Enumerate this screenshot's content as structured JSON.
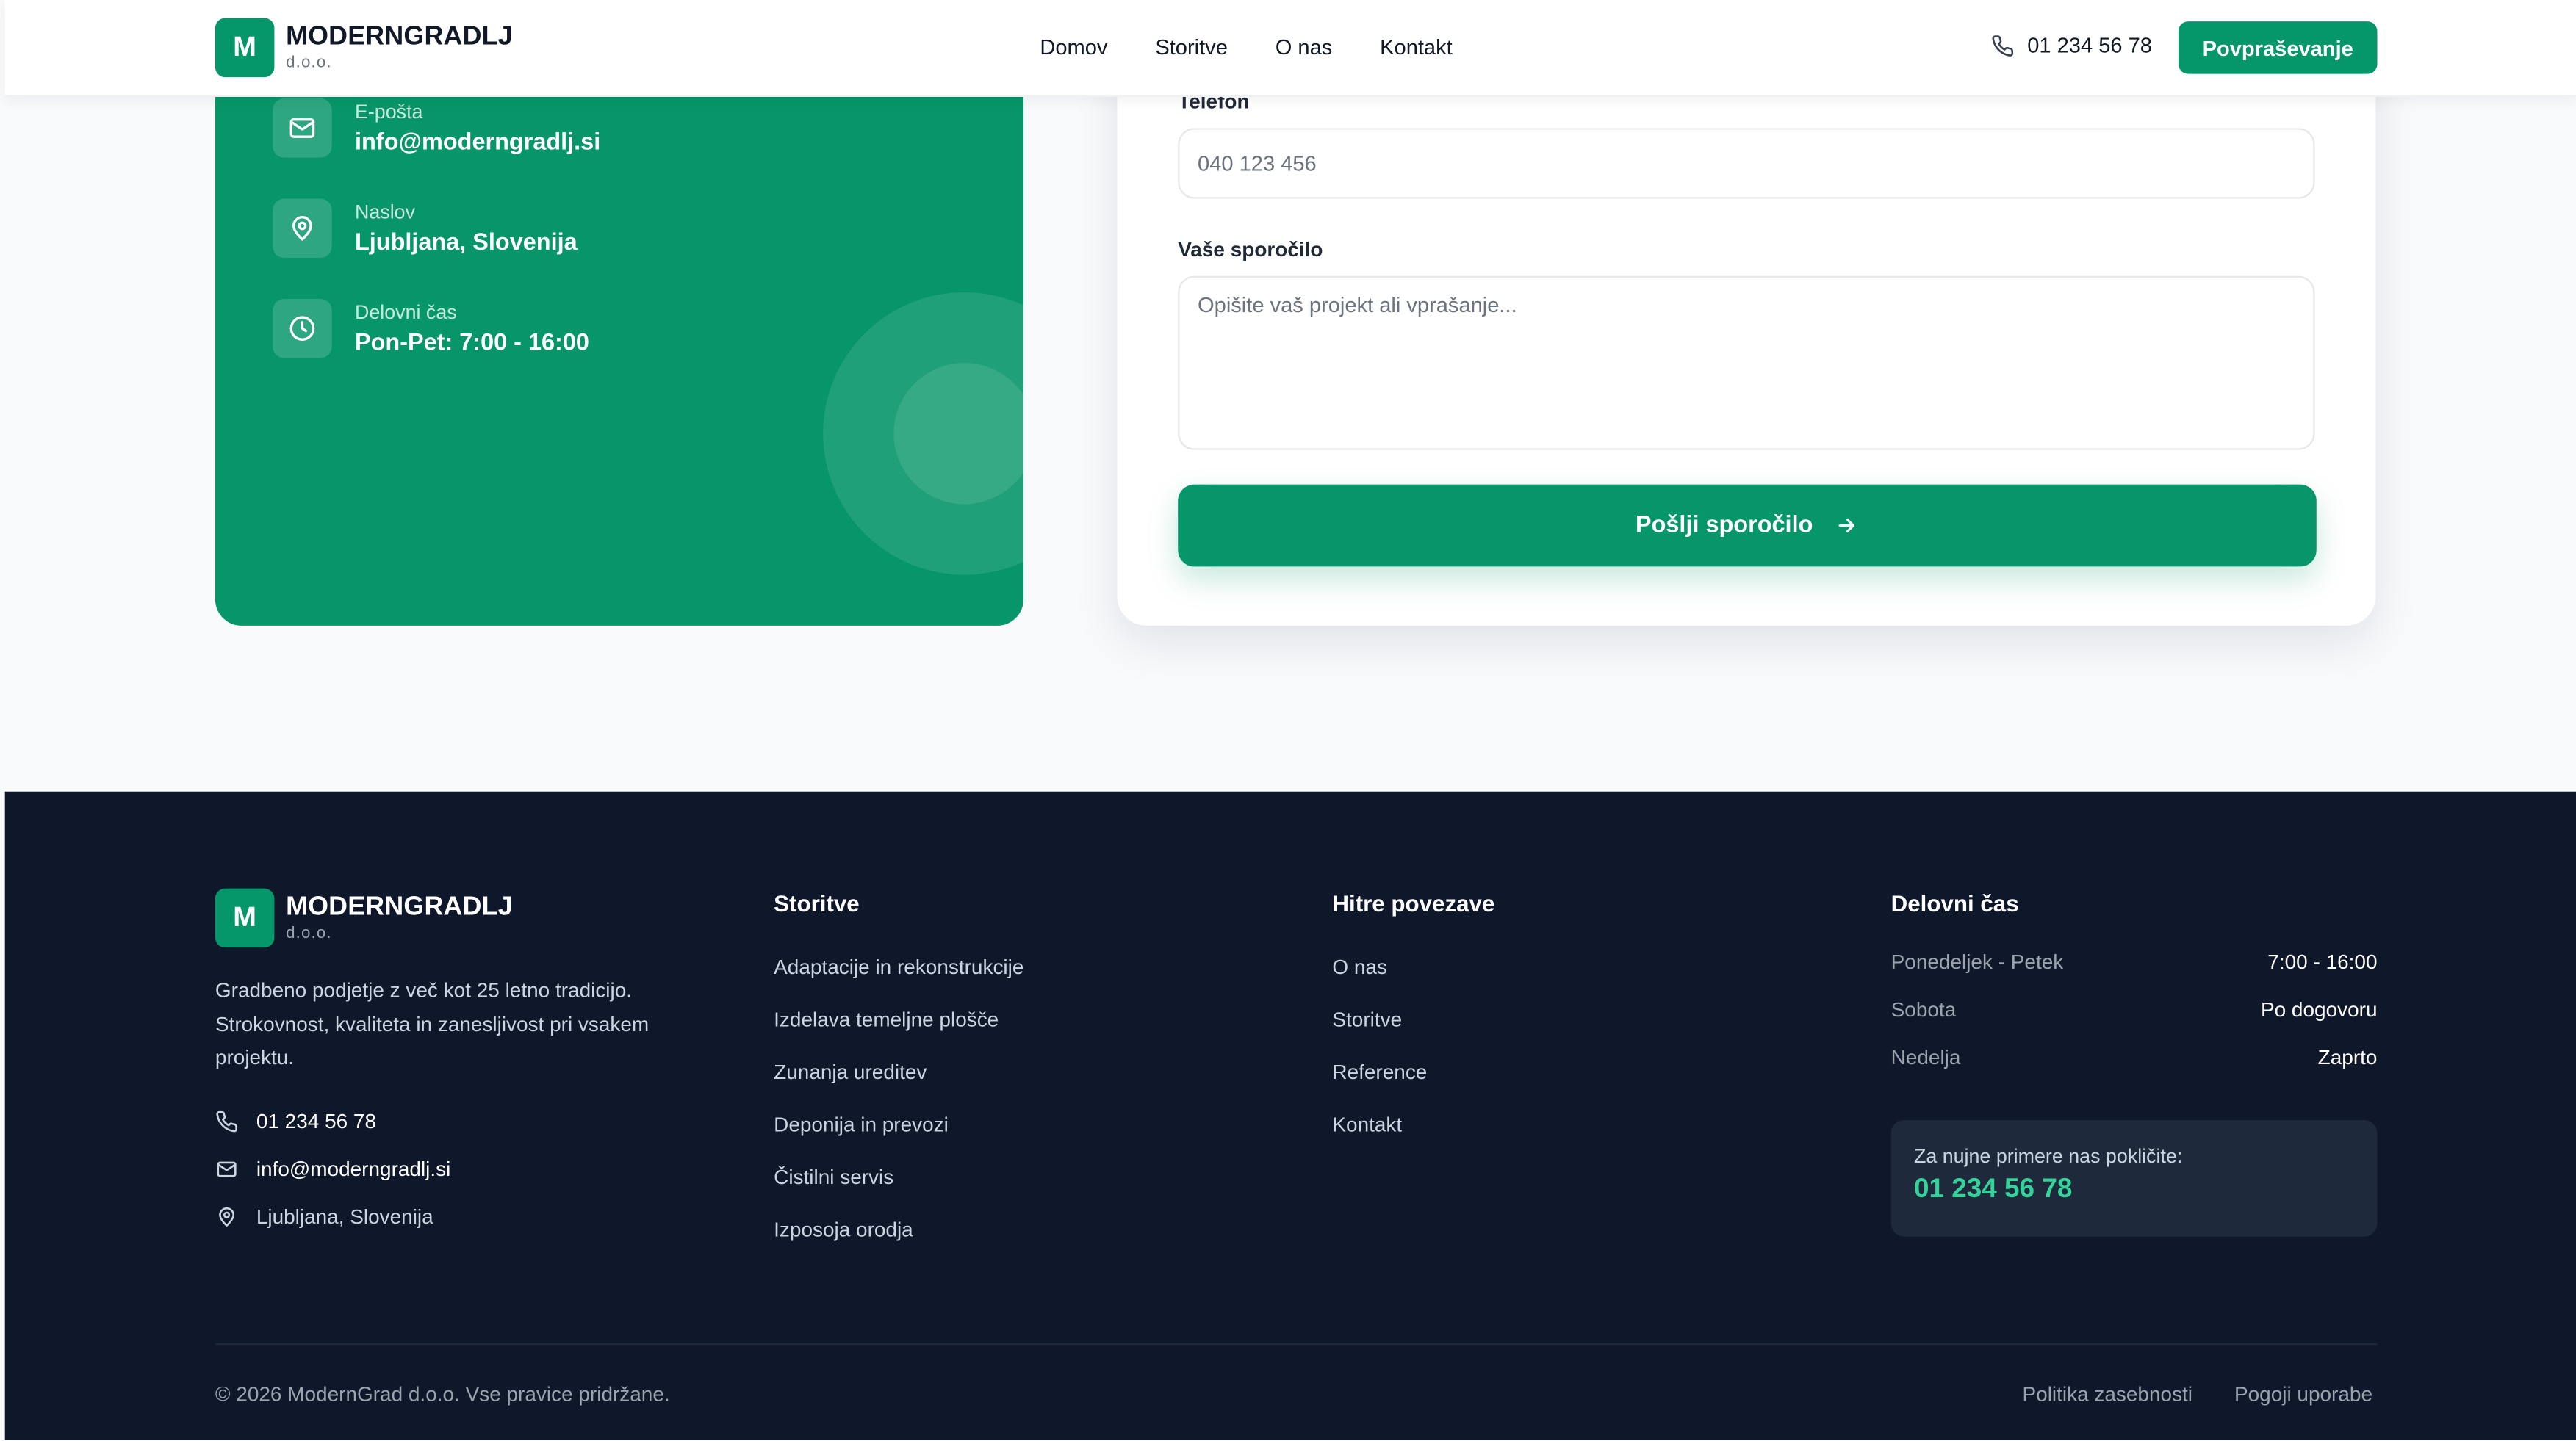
{
  "brand": {
    "mark": "M",
    "name": "MODERNGRADLJ",
    "suffix": "d.o.o."
  },
  "nav": {
    "links": [
      "Domov",
      "Storitve",
      "O nas",
      "Kontakt"
    ],
    "phone": "01 234 56 78",
    "cta_label": "Povpraševanje"
  },
  "info_card": {
    "items": [
      {
        "label": "E-pošta",
        "value": "info@moderngradlj.si",
        "icon": "mail-icon"
      },
      {
        "label": "Naslov",
        "value": "Ljubljana, Slovenija",
        "icon": "location-pin-icon"
      },
      {
        "label": "Delovni čas",
        "value": "Pon-Pet: 7:00 - 16:00",
        "icon": "clock-icon"
      }
    ]
  },
  "form": {
    "phone_label": "Telefon",
    "phone_placeholder": "040 123 456",
    "message_label": "Vaše sporočilo",
    "message_placeholder": "Opišite vaš projekt ali vprašanje...",
    "submit_label": "Pošlji sporočilo"
  },
  "footer": {
    "description": "Gradbeno podjetje z več kot 25 letno tradicijo. Strokovnost, kvaliteta in zanesljivost pri vsakem projektu.",
    "contact": {
      "phone": "01 234 56 78",
      "email": "info@moderngradlj.si",
      "address": "Ljubljana, Slovenija"
    },
    "services_heading": "Storitve",
    "services": [
      "Adaptacije in rekonstrukcije",
      "Izdelava temeljne plošče",
      "Zunanja ureditev",
      "Deponija in prevozi",
      "Čistilni servis",
      "Izposoja orodja"
    ],
    "quicklinks_heading": "Hitre povezave",
    "quicklinks": [
      "O nas",
      "Storitve",
      "Reference",
      "Kontakt"
    ],
    "hours_heading": "Delovni čas",
    "hours": [
      {
        "day": "Ponedeljek - Petek",
        "time": "7:00 - 16:00"
      },
      {
        "day": "Sobota",
        "time": "Po dogovoru"
      },
      {
        "day": "Nedelja",
        "time": "Zaprto"
      }
    ],
    "urgent_label": "Za nujne primere nas pokličite:",
    "urgent_phone": "01 234 56 78",
    "copyright": "© 2026 ModernGrad d.o.o. Vse pravice pridržane.",
    "legal": [
      "Politika zasebnosti",
      "Pogoji uporabe"
    ]
  },
  "colors": {
    "brand_green": "#059669",
    "footer_bg": "#0f172a",
    "urgent_phone": "#34d399"
  }
}
